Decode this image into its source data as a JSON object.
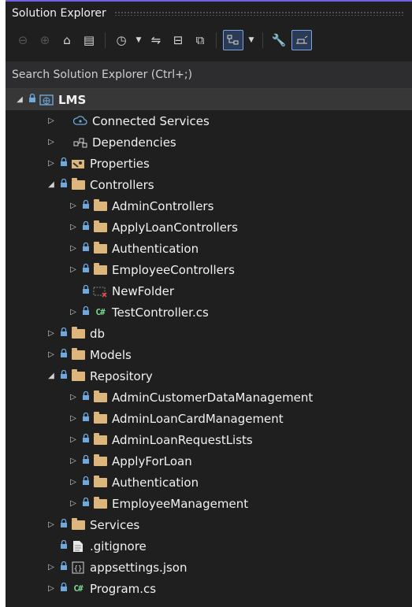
{
  "window": {
    "title": "Solution Explorer"
  },
  "search": {
    "placeholder": "Search Solution Explorer (Ctrl+;)"
  },
  "colors": {
    "accent": "#7160e8",
    "folder": "#dcb67a",
    "lock": "#6fa8dc",
    "csharp": "#7bd88f"
  },
  "tree": {
    "root": "LMS",
    "connected_services": "Connected Services",
    "dependencies": "Dependencies",
    "properties": "Properties",
    "controllers": "Controllers",
    "admin_controllers": "AdminControllers",
    "apply_loan_controllers": "ApplyLoanControllers",
    "authentication": "Authentication",
    "employee_controllers": "EmployeeControllers",
    "new_folder": "NewFolder",
    "test_controller": "TestController.cs",
    "db": "db",
    "models": "Models",
    "repository": "Repository",
    "admin_customer_data_management": "AdminCustomerDataManagement",
    "admin_loan_card_management": "AdminLoanCardManagement",
    "admin_loan_request_lists": "AdminLoanRequestLists",
    "apply_for_loan": "ApplyForLoan",
    "repo_authentication": "Authentication",
    "employee_management": "EmployeeManagement",
    "services": "Services",
    "gitignore": ".gitignore",
    "appsettings": "appsettings.json",
    "program": "Program.cs"
  },
  "icons": {
    "csharp_glyph": "C#"
  }
}
